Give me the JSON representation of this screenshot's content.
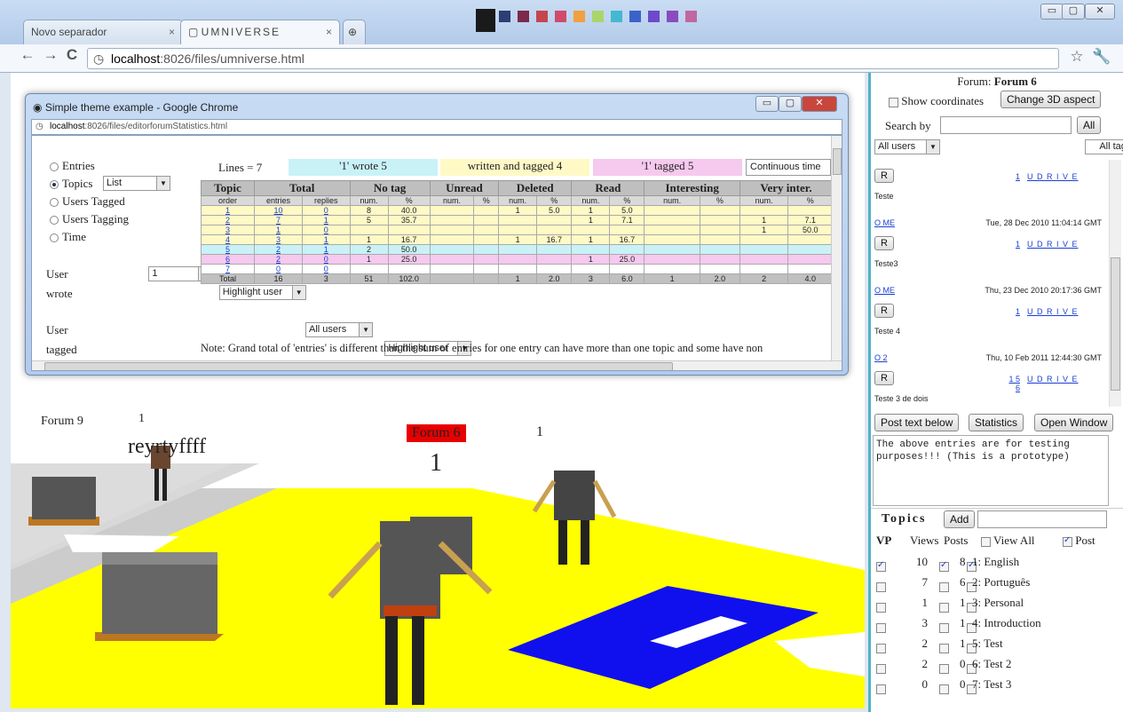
{
  "browser": {
    "tabs": [
      {
        "label": "Novo separador"
      },
      {
        "label": "UMNIVERSE"
      }
    ],
    "url_host": "localhost",
    "url_rest": ":8026/files/umniverse.html",
    "swatch_colors": [
      "#1a1a1a",
      "#2c3e73",
      "#7a2a4a",
      "#c5454e",
      "#d04a6a",
      "#f0a040",
      "#a9d66a",
      "#44b8d0",
      "#3b62c9",
      "#6d4ac9",
      "#8a4ac0",
      "#c066a0"
    ]
  },
  "popup": {
    "title": "Simple theme example - Google Chrome",
    "url_host": "localhost",
    "url_rest": ":8026/files/editorforumStatistics.html",
    "radios": [
      {
        "label": "Entries",
        "on": false
      },
      {
        "label": "Topics",
        "on": true
      },
      {
        "label": "Users Tagged",
        "on": false
      },
      {
        "label": "Users Tagging",
        "on": false
      },
      {
        "label": "Time",
        "on": false
      }
    ],
    "topics_select": "List",
    "user_label": "User",
    "user_value": "1",
    "wrote_label": "wrote",
    "wrote_value": "Highlight user",
    "user2_label": "User",
    "user2_value": "All users",
    "tagged_label": "tagged",
    "tagged_value": "Highlight user",
    "lines": "Lines = 7",
    "legend": {
      "wrote": "'1' wrote 5",
      "written_tagged": "written and tagged 4",
      "tagged": "'1' tagged 5",
      "continuous": "Continuous time"
    },
    "headers": [
      "Topic",
      "Total",
      "No tag",
      "Unread",
      "Deleted",
      "Read",
      "Interesting",
      "Very inter."
    ],
    "subheaders": [
      "order",
      "entries",
      "replies",
      "num.",
      "%",
      "num.",
      "%",
      "num.",
      "%",
      "num.",
      "%",
      "num.",
      "%",
      "num.",
      "%"
    ],
    "rows": [
      {
        "cls": "yel",
        "c": [
          "1",
          "10",
          "0",
          "8",
          "40.0",
          "",
          "",
          "1",
          "5.0",
          "1",
          "5.0",
          "",
          "",
          "",
          ""
        ]
      },
      {
        "cls": "yel",
        "c": [
          "2",
          "7",
          "1",
          "5",
          "35.7",
          "",
          "",
          "",
          "",
          "1",
          "7.1",
          "",
          "",
          "1",
          "7.1"
        ]
      },
      {
        "cls": "yel",
        "c": [
          "3",
          "1",
          "0",
          "",
          "",
          "",
          "",
          "",
          "",
          "",
          "",
          "",
          "",
          "1",
          "50.0"
        ]
      },
      {
        "cls": "yel",
        "c": [
          "4",
          "3",
          "1",
          "1",
          "16.7",
          "",
          "",
          "1",
          "16.7",
          "1",
          "16.7",
          "",
          "",
          "",
          ""
        ]
      },
      {
        "cls": "cy",
        "c": [
          "5",
          "2",
          "1",
          "2",
          "50.0",
          "",
          "",
          "",
          "",
          "",
          "",
          "",
          "",
          "",
          ""
        ]
      },
      {
        "cls": "pk",
        "c": [
          "6",
          "2",
          "0",
          "1",
          "25.0",
          "",
          "",
          "",
          "",
          "1",
          "25.0",
          "",
          "",
          "",
          ""
        ]
      },
      {
        "cls": "wh",
        "c": [
          "7",
          "0",
          "0",
          "",
          "",
          "",
          "",
          "",
          "",
          "",
          "",
          "",
          "",
          "",
          ""
        ]
      }
    ],
    "total": [
      "Total",
      "16",
      "3",
      "51",
      "102.0",
      "",
      "",
      "1",
      "2.0",
      "3",
      "6.0",
      "1",
      "2.0",
      "2",
      "4.0"
    ],
    "note": "Note: Grand total of 'entries' is different than the sum of entries for one entry can have more than one topic and some have non"
  },
  "scene": {
    "forum9": "Forum 9",
    "forum9_count": "1",
    "user_text": "reyrtyffff",
    "forum6_label": "Forum 6",
    "forum6_count": "1",
    "robot_count": "1"
  },
  "panel": {
    "forum_prefix": "Forum: ",
    "forum_name": "Forum 6",
    "show_coords": "Show coordinates",
    "change_aspect": "Change 3D aspect",
    "search_by": "Search by",
    "all_btn": "All",
    "users_select": "All users",
    "tags_select": "All tags",
    "entries": [
      {
        "user": "",
        "date": "",
        "nums": "1",
        "flags": "U D R I V E",
        "text": "Teste"
      },
      {
        "user": "O ME",
        "date": "Tue, 28 Dec 2010 11:04:14 GMT",
        "nums": "1",
        "flags": "U D R I V E",
        "text": "Teste3"
      },
      {
        "user": "O ME",
        "date": "Thu, 23 Dec 2010 20:17:36 GMT",
        "nums": "1",
        "flags": "U D R I V E",
        "text": "Teste 4"
      },
      {
        "user": "O 2",
        "date": "Thu, 10 Feb 2011 12:44:30 GMT",
        "nums": "1 5 6",
        "flags": "U D R I V E",
        "text": "Teste 3 de dois"
      }
    ],
    "r_btn": "R",
    "post_btn": "Post text below",
    "stats_btn": "Statistics",
    "open_btn": "Open Window",
    "textarea": "The above entries are for testing purposes!!! (This is a prototype)",
    "topics_title": "Topics",
    "add_btn": "Add",
    "topics_hdr": {
      "vp": "VP",
      "views": "Views",
      "posts": "Posts",
      "view_all": "View All",
      "post": "Post"
    },
    "topics": [
      {
        "views": "10",
        "posts": "8",
        "name": "1: English",
        "vp": true,
        "v": true,
        "p": true
      },
      {
        "views": "7",
        "posts": "6",
        "name": "2: Português",
        "vp": false,
        "v": false,
        "p": false
      },
      {
        "views": "1",
        "posts": "1",
        "name": "3: Personal",
        "vp": false,
        "v": false,
        "p": false
      },
      {
        "views": "3",
        "posts": "1",
        "name": "4: Introduction",
        "vp": false,
        "v": false,
        "p": false
      },
      {
        "views": "2",
        "posts": "1",
        "name": "5: Test",
        "vp": false,
        "v": false,
        "p": false
      },
      {
        "views": "2",
        "posts": "0",
        "name": "6: Test 2",
        "vp": false,
        "v": false,
        "p": false
      },
      {
        "views": "0",
        "posts": "0",
        "name": "7: Test 3",
        "vp": false,
        "v": false,
        "p": false
      }
    ]
  }
}
